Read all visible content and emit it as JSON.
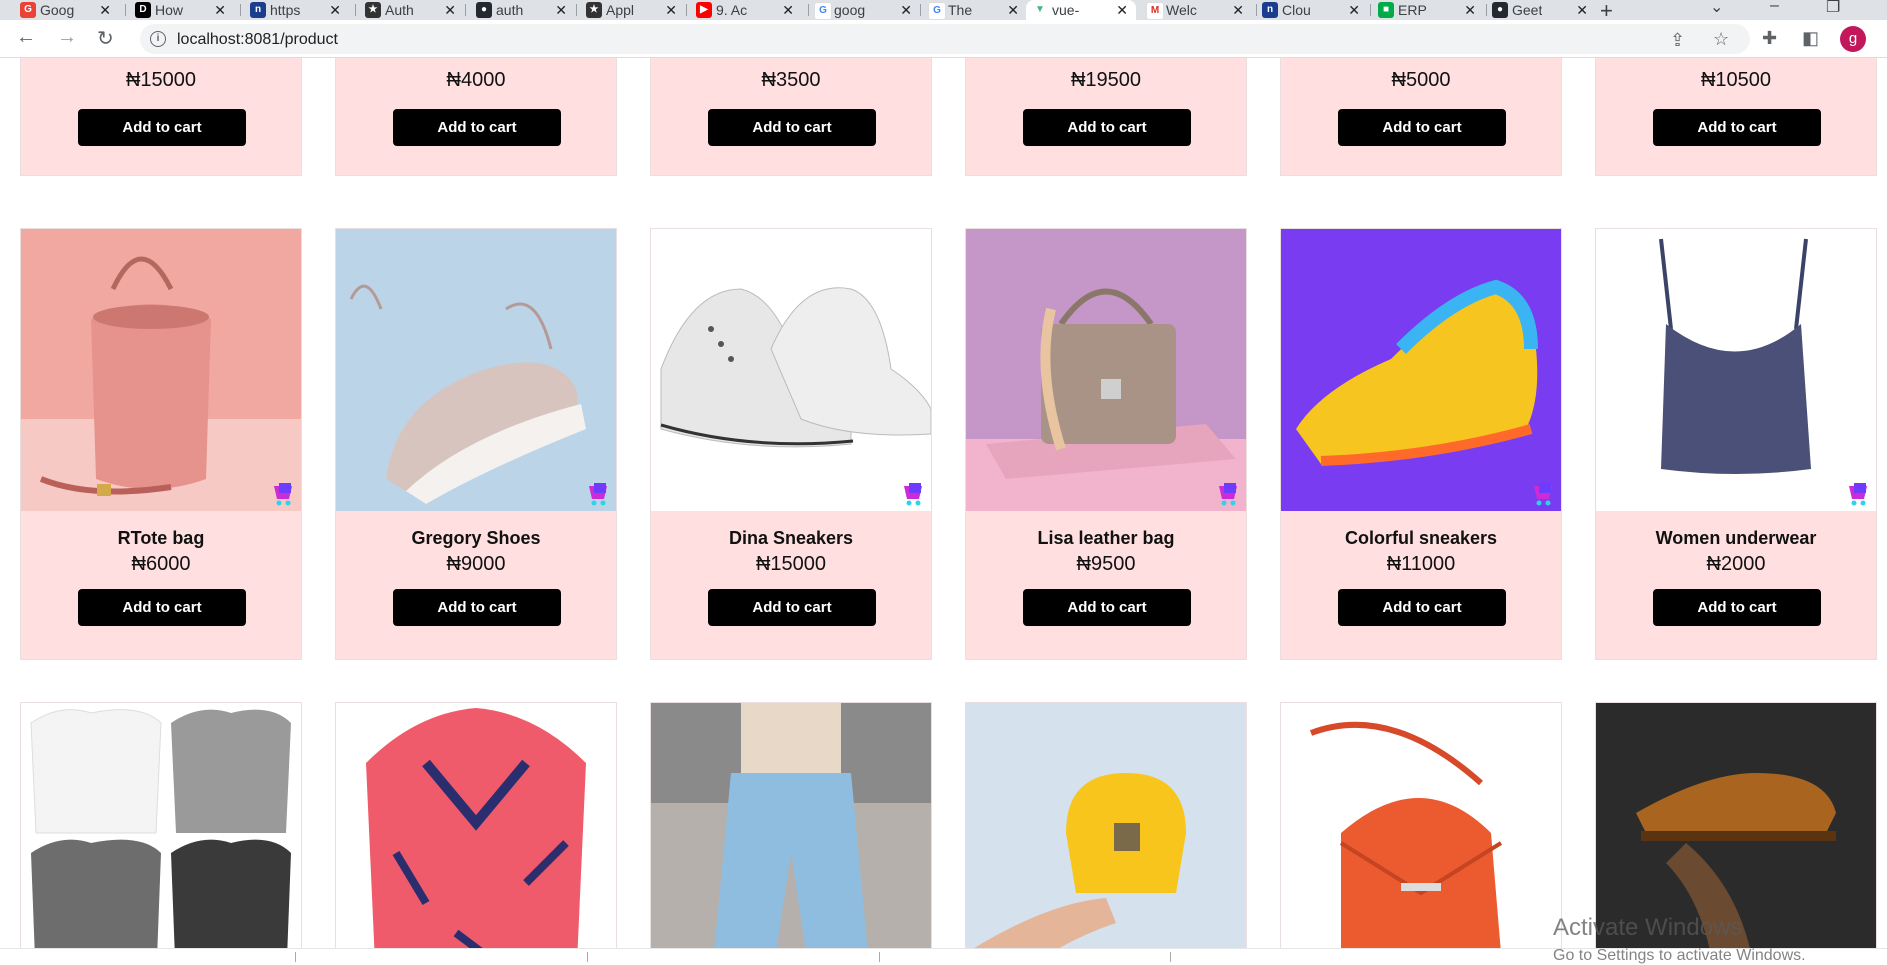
{
  "browser": {
    "tabs": [
      {
        "title": "Goog",
        "icon": "google-apps-icon",
        "color": "#ea4335"
      },
      {
        "title": "How",
        "icon": "dev-icon",
        "color": "#000000"
      },
      {
        "title": "https",
        "icon": "ng-icon",
        "color": "#1a3d8f"
      },
      {
        "title": "Auth",
        "icon": "star-icon",
        "color": "#333333"
      },
      {
        "title": "auth",
        "icon": "github-icon",
        "color": "#24292f"
      },
      {
        "title": "Appl",
        "icon": "star-icon",
        "color": "#333333"
      },
      {
        "title": "9. Ac",
        "icon": "youtube-icon",
        "color": "#ff0000"
      },
      {
        "title": "goog",
        "icon": "google-icon",
        "color": "#4285f4"
      },
      {
        "title": "The",
        "icon": "google-icon",
        "color": "#4285f4"
      },
      {
        "title": "vue-",
        "icon": "vue-icon",
        "color": "#42b883"
      },
      {
        "title": "Welc",
        "icon": "gmail-icon",
        "color": "#d93025"
      },
      {
        "title": "Clou",
        "icon": "ng-icon",
        "color": "#1a3d8f"
      },
      {
        "title": "ERP",
        "icon": "chat-icon",
        "color": "#00ac47"
      },
      {
        "title": "Geet",
        "icon": "github-icon",
        "color": "#24292f"
      }
    ],
    "active_tab": 9,
    "url": "localhost:8081/product",
    "profile_initial": "g"
  },
  "products": {
    "button_label": "Add to cart",
    "row_top": [
      {
        "price": "₦15000"
      },
      {
        "price": "₦4000"
      },
      {
        "price": "₦3500"
      },
      {
        "price": "₦19500"
      },
      {
        "price": "₦5000"
      },
      {
        "price": "₦10500"
      }
    ],
    "row_middle": [
      {
        "name": "RTote bag",
        "price": "₦6000",
        "image": "pink-bucket-bag"
      },
      {
        "name": "Gregory Shoes",
        "price": "₦9000",
        "image": "beige-sneaker"
      },
      {
        "name": "Dina Sneakers",
        "price": "₦15000",
        "image": "white-high-top-sneakers"
      },
      {
        "name": "Lisa leather bag",
        "price": "₦9500",
        "image": "taupe-handbag"
      },
      {
        "name": "Colorful sneakers",
        "price": "₦11000",
        "image": "colorful-sneaker"
      },
      {
        "name": "Women underwear",
        "price": "₦2000",
        "image": "navy-camisole"
      }
    ],
    "row_bottom": [
      {
        "image": "long-sleeve-shirts"
      },
      {
        "image": "floral-shirt"
      },
      {
        "image": "mom-jeans"
      },
      {
        "image": "yellow-bag"
      },
      {
        "image": "orange-bag"
      },
      {
        "image": "brown-oxford-shoe"
      }
    ]
  },
  "watermark": {
    "title": "Activate Windows",
    "subtitle": "Go to Settings to activate Windows."
  }
}
